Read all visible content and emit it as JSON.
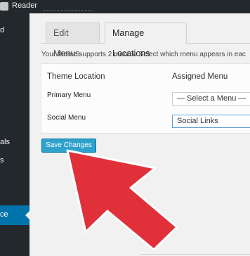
{
  "admin_bar": {
    "logo_icon": "wordpress-logo-icon",
    "reader_label": "Reader"
  },
  "sidebar": {
    "items": [
      {
        "label": "d"
      },
      {
        "label": "als"
      },
      {
        "label": "s"
      },
      {
        "label": "ce"
      }
    ],
    "active_color": "#0073aa",
    "bg_color": "#23282d"
  },
  "tabs": {
    "edit_menus": "Edit Menus",
    "manage_locations": "Manage Locations"
  },
  "info_text": "Your theme supports 2 menus. Select which menu appears in eac",
  "table": {
    "col_location": "Theme Location",
    "col_assigned": "Assigned Menu",
    "rows": [
      {
        "location": "Primary Menu",
        "menu": "— Select a Menu —"
      },
      {
        "location": "Social Menu",
        "menu": "Social Links"
      }
    ]
  },
  "save_button": "Save Changes",
  "accent_color": "#2ea2cc",
  "cursor_icon": "red-arrow-cursor-icon",
  "cursor_color": "#e0313a"
}
